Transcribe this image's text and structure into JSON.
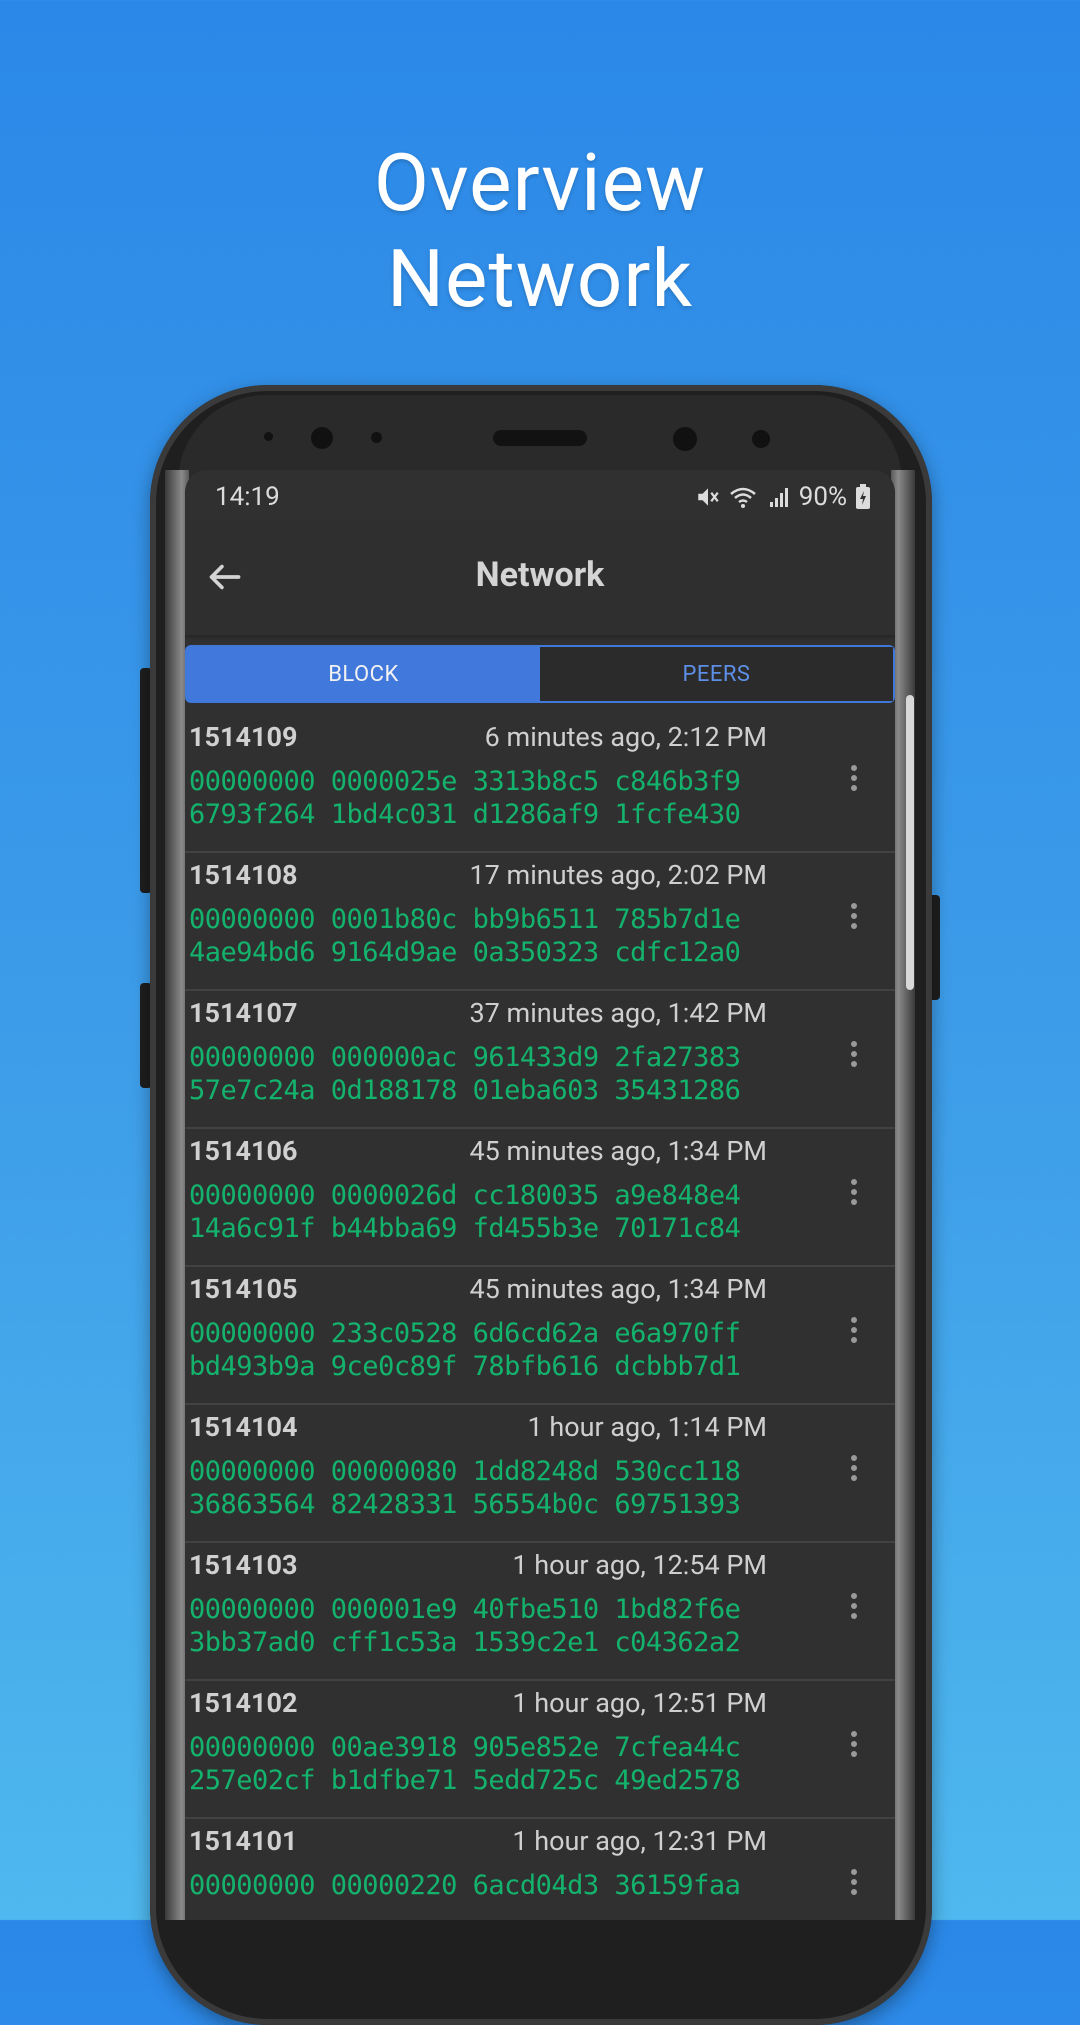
{
  "hero": {
    "line1": "Overview",
    "line2": "Network"
  },
  "status_bar": {
    "time": "14:19",
    "battery": "90%"
  },
  "app_bar": {
    "title": "Network"
  },
  "tabs": [
    {
      "label": "BLOCK",
      "active": true
    },
    {
      "label": "PEERS",
      "active": false
    }
  ],
  "blocks": [
    {
      "number": "1514109",
      "time": "6 minutes ago, 2:12 PM",
      "hash1": "00000000 0000025e 3313b8c5 c846b3f9",
      "hash2": "6793f264 1bd4c031 d1286af9 1fcfe430"
    },
    {
      "number": "1514108",
      "time": "17 minutes ago, 2:02 PM",
      "hash1": "00000000 0001b80c bb9b6511 785b7d1e",
      "hash2": "4ae94bd6 9164d9ae 0a350323 cdfc12a0"
    },
    {
      "number": "1514107",
      "time": "37 minutes ago, 1:42 PM",
      "hash1": "00000000 000000ac 961433d9 2fa27383",
      "hash2": "57e7c24a 0d188178 01eba603 35431286"
    },
    {
      "number": "1514106",
      "time": "45 minutes ago, 1:34 PM",
      "hash1": "00000000 0000026d cc180035 a9e848e4",
      "hash2": "14a6c91f b44bba69 fd455b3e 70171c84"
    },
    {
      "number": "1514105",
      "time": "45 minutes ago, 1:34 PM",
      "hash1": "00000000 233c0528 6d6cd62a e6a970ff",
      "hash2": "bd493b9a 9ce0c89f 78bfb616 dcbbb7d1"
    },
    {
      "number": "1514104",
      "time": "1 hour ago, 1:14 PM",
      "hash1": "00000000 00000080 1dd8248d 530cc118",
      "hash2": "36863564 82428331 56554b0c 69751393"
    },
    {
      "number": "1514103",
      "time": "1 hour ago, 12:54 PM",
      "hash1": "00000000 000001e9 40fbe510 1bd82f6e",
      "hash2": "3bb37ad0 cff1c53a 1539c2e1 c04362a2"
    },
    {
      "number": "1514102",
      "time": "1 hour ago, 12:51 PM",
      "hash1": "00000000 00ae3918 905e852e 7cfea44c",
      "hash2": "257e02cf b1dfbe71 5edd725c 49ed2578"
    },
    {
      "number": "1514101",
      "time": "1 hour ago, 12:31 PM",
      "hash1": "00000000 00000220 6acd04d3 36159faa",
      "hash2": ""
    }
  ],
  "colors": {
    "accent": "#4178dc",
    "hash_green": "#14b36d",
    "surface": "#303030"
  },
  "icons": [
    "back-arrow-icon",
    "mute-icon",
    "wifi-icon",
    "signal-icon",
    "battery-icon",
    "more-vert-icon"
  ]
}
